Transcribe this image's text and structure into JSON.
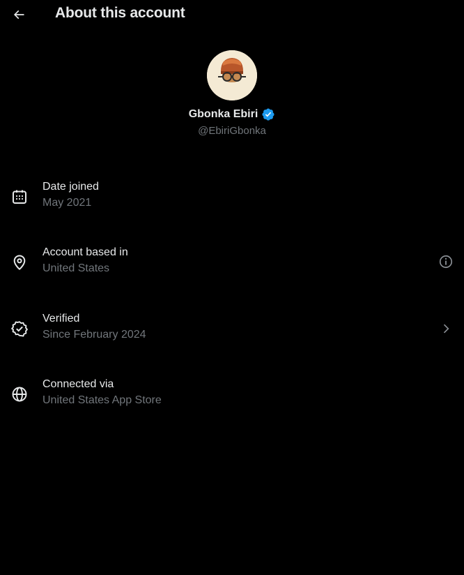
{
  "header": {
    "title": "About this account",
    "back_icon": "arrow-left-icon"
  },
  "profile": {
    "display_name": "Gbonka Ebiri",
    "handle": "@EbiriGbonka",
    "verified_badge_icon": "verified-badge-icon",
    "verified_badge_color": "#1d9bf0",
    "avatar_icon": "cartoon-avatar-with-glasses"
  },
  "rows": [
    {
      "title": "Date joined",
      "subtitle": "May 2021",
      "icon": "calendar-icon"
    },
    {
      "title": "Account based in",
      "subtitle": "United States",
      "icon": "location-pin-icon",
      "action_icon": "info-icon"
    },
    {
      "title": "Verified",
      "subtitle": "Since February 2024",
      "icon": "verified-check-icon",
      "action_icon": "chevron-right-icon"
    },
    {
      "title": "Connected via",
      "subtitle": "United States App Store",
      "icon": "globe-icon"
    }
  ],
  "colors": {
    "background": "#000000",
    "primary_text": "#e7e9ea",
    "secondary_text": "#71767b",
    "accent": "#1d9bf0"
  }
}
